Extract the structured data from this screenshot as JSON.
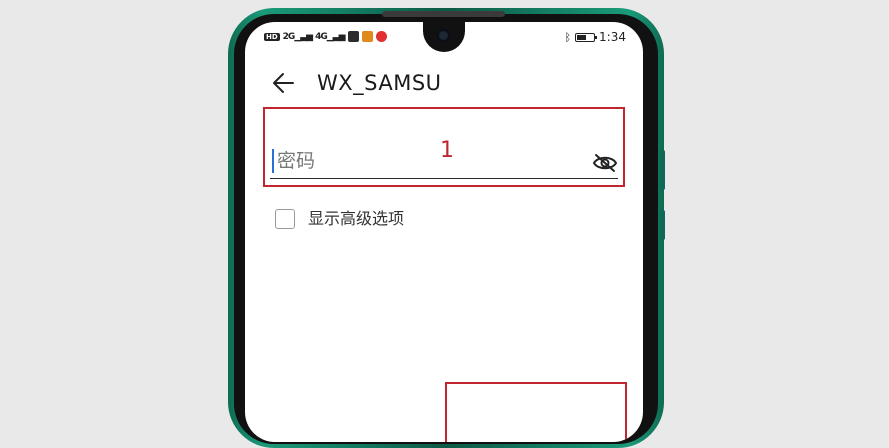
{
  "status_bar": {
    "hd_label": "HD",
    "signal_1": "2G",
    "signal_2": "4G",
    "time": "1:34"
  },
  "header": {
    "title": "WX_SAMSU"
  },
  "password_field": {
    "placeholder": "密码"
  },
  "annotations": {
    "marker_1": "1"
  },
  "advanced_option": {
    "label": "显示高级选项"
  },
  "icons": {
    "back": "arrow-left",
    "visibility": "eye-off",
    "bluetooth": "bluetooth",
    "battery": "battery"
  },
  "colors": {
    "frame": "#14876a",
    "annotation": "#c0262d",
    "cursor": "#2b6fd6"
  }
}
